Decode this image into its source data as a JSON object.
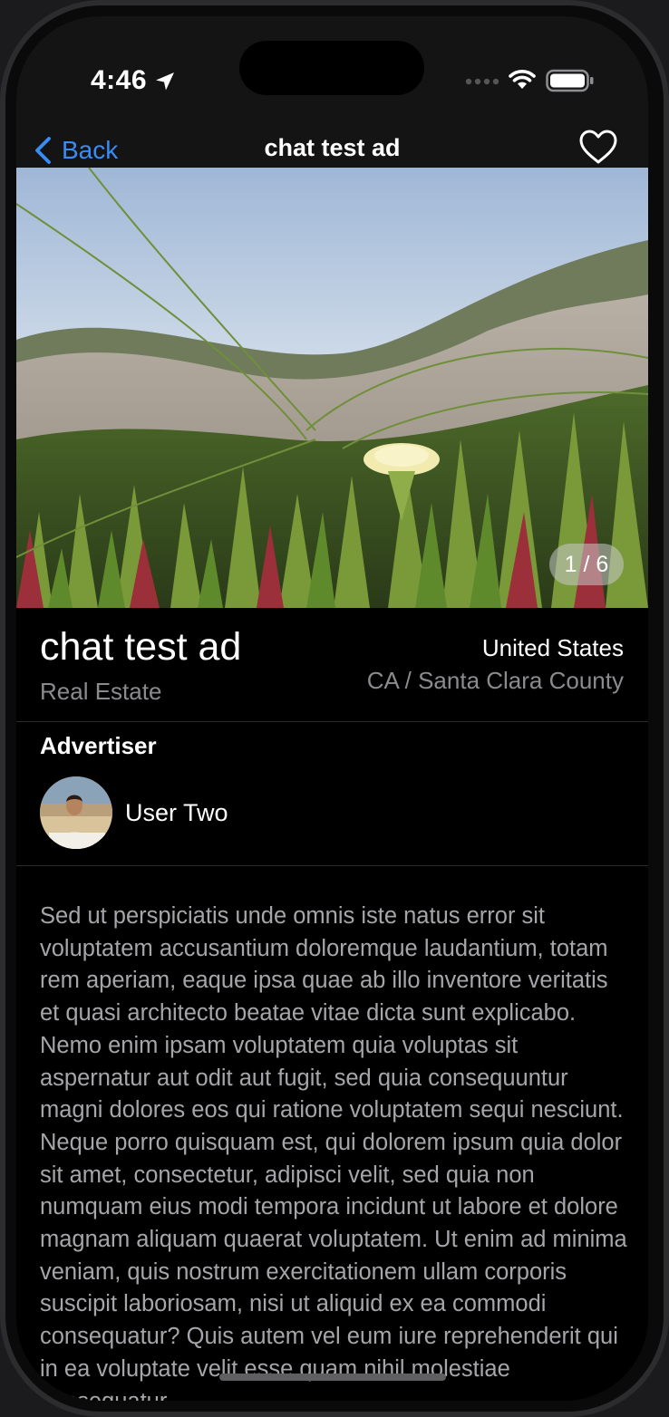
{
  "status_bar": {
    "time": "4:46",
    "icons": [
      "location-arrow-icon",
      "cellular-signal-icon",
      "wifi-icon",
      "battery-icon"
    ]
  },
  "nav": {
    "back_label": "Back",
    "title": "chat test ad",
    "favorite_icon": "heart-outline-icon",
    "accent_color": "#3a8cf5"
  },
  "gallery": {
    "page_indicator": "1 / 6",
    "current_page": 1,
    "total_pages": 6
  },
  "listing": {
    "title": "chat test ad",
    "category": "Real Estate",
    "country": "United States",
    "region": "CA / Santa Clara County"
  },
  "advertiser": {
    "heading": "Advertiser",
    "name": "User Two"
  },
  "description": "Sed ut perspiciatis unde omnis iste natus error sit voluptatem accusantium doloremque laudantium, totam rem aperiam, eaque ipsa quae ab illo inventore veritatis et quasi architecto beatae vitae dicta sunt explicabo. Nemo enim ipsam voluptatem quia voluptas sit aspernatur aut odit aut fugit, sed quia consequuntur magni dolores eos qui ratione voluptatem sequi nesciunt. Neque porro quisquam est, qui dolorem ipsum quia dolor sit amet, consectetur, adipisci velit, sed quia non numquam eius modi tempora incidunt ut labore et dolore magnam aliquam quaerat voluptatem. Ut enim ad minima veniam, quis nostrum exercitationem ullam corporis suscipit laboriosam, nisi ut aliquid ex ea commodi consequatur? Quis autem vel eum iure reprehenderit qui in ea voluptate velit esse quam nihil molestiae consequatur"
}
